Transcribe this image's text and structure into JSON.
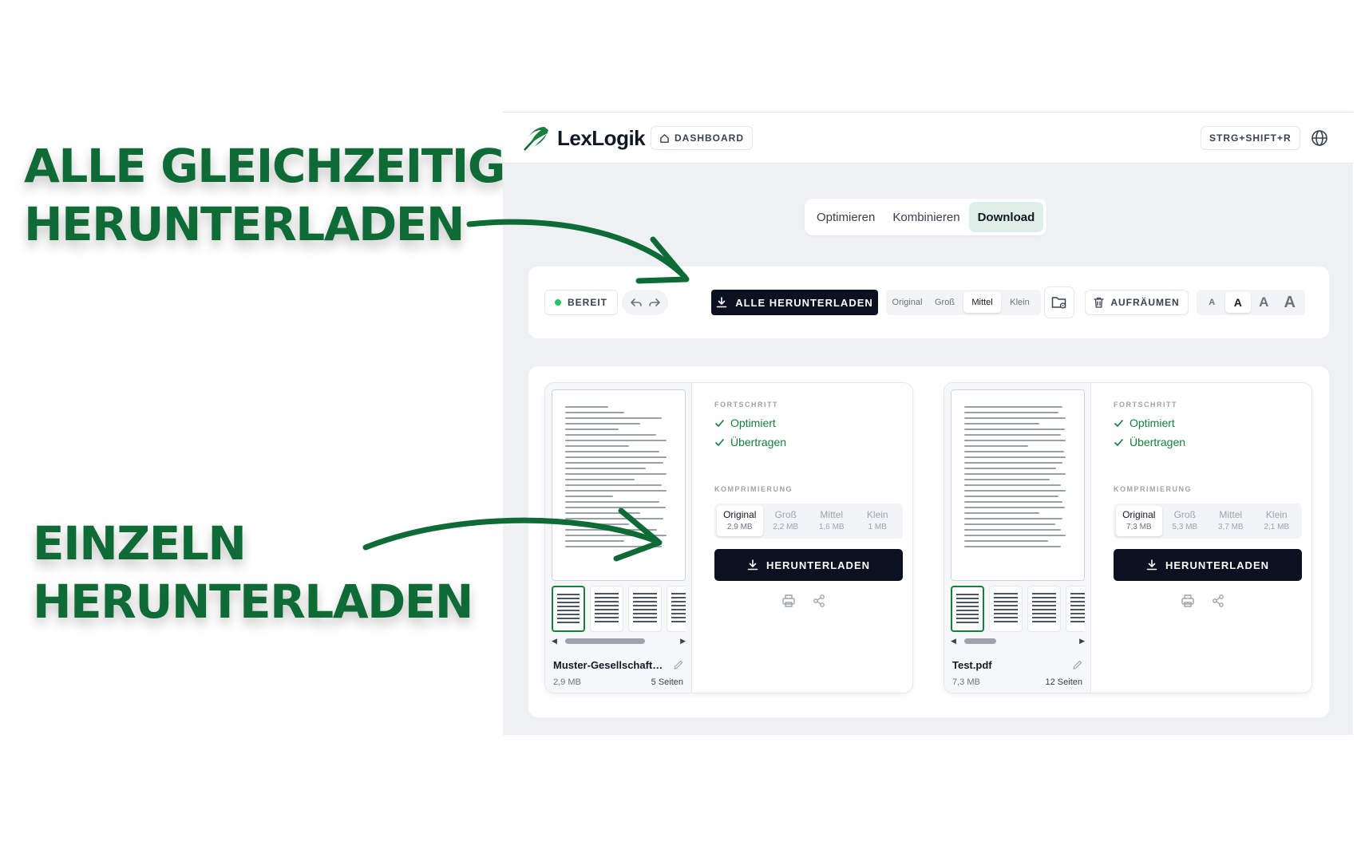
{
  "annotations": {
    "top_line1": "ALLE GLEICHZEITIG",
    "top_line2": "HERUNTERLADEN",
    "bottom_line1": "EINZELN",
    "bottom_line2": "HERUNTERLADEN"
  },
  "header": {
    "logo_text": "LexLogik",
    "dashboard_label": "DASHBOARD",
    "shortcut_label": "STRG+SHIFT+R",
    "language_icon": "globe-icon"
  },
  "mode_tabs": [
    {
      "label": "Optimieren",
      "active": false
    },
    {
      "label": "Kombinieren",
      "active": false
    },
    {
      "label": "Download",
      "active": true
    }
  ],
  "toolbar": {
    "status": "BEREIT",
    "download_all_label": "ALLE HERUNTERLADEN",
    "size_options": [
      "Original",
      "Groß",
      "Mittel",
      "Klein"
    ],
    "size_selected": "Mittel",
    "cleanup_label": "AUFRÄUMEN",
    "font_sizes": [
      "A",
      "A",
      "A",
      "A"
    ]
  },
  "labels": {
    "progress": "FORTSCHRITT",
    "compression": "KOMPRIMIERUNG",
    "download": "HERUNTERLADEN"
  },
  "files": [
    {
      "name": "Muster-Gesellschaftsv...",
      "size": "2,9 MB",
      "pages": "5 Seiten",
      "steps": [
        "Optimiert",
        "Übertragen"
      ],
      "compression": [
        {
          "label": "Original",
          "size": "2,9 MB"
        },
        {
          "label": "Groß",
          "size": "2,2 MB"
        },
        {
          "label": "Mittel",
          "size": "1,6 MB"
        },
        {
          "label": "Klein",
          "size": "1 MB"
        }
      ]
    },
    {
      "name": "Test.pdf",
      "size": "7,3 MB",
      "pages": "12 Seiten",
      "steps": [
        "Optimiert",
        "Übertragen"
      ],
      "compression": [
        {
          "label": "Original",
          "size": "7,3 MB"
        },
        {
          "label": "Groß",
          "size": "5,3 MB"
        },
        {
          "label": "Mittel",
          "size": "3,7 MB"
        },
        {
          "label": "Klein",
          "size": "2,1 MB"
        }
      ]
    }
  ],
  "colors": {
    "brand_green": "#0f6b35",
    "success_green": "#15803d",
    "primary_dark": "#0b1120",
    "status_dot": "#22c55e"
  }
}
